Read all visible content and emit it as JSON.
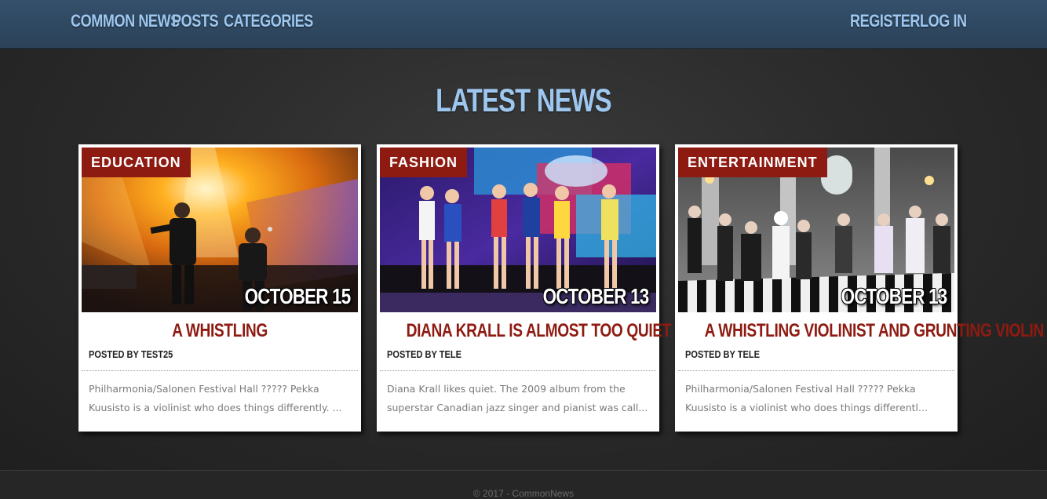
{
  "nav": {
    "brand": "COMMON NEWS",
    "posts": "POSTS",
    "categories": "CATEGORIES",
    "register": "REGISTER",
    "login": "LOG IN"
  },
  "section_title": "LATEST NEWS",
  "cards": [
    {
      "category": "EDUCATION",
      "date": "OCTOBER 15",
      "title": "A WHISTLING",
      "posted_by": "POSTED BY TEST25",
      "excerpt": "Philharmonia/Salonen Festival Hall ????? Pekka Kuusisto is a violinist who does things differently. ..."
    },
    {
      "category": "FASHION",
      "date": "OCTOBER 13",
      "title": "DIANA KRALL IS ALMOST TOO QUIET",
      "posted_by": "POSTED BY TELE",
      "excerpt": "Diana Krall likes quiet. The 2009 album from the superstar Canadian jazz singer and pianist was call..."
    },
    {
      "category": "ENTERTAINMENT",
      "date": "OCTOBER 13",
      "title": "A WHISTLING VIOLINIST AND GRUNTING VIOLIN",
      "posted_by": "POSTED BY TELE",
      "excerpt": "Philharmonia/Salonen Festival Hall ????? Pekka Kuusisto is a violinist who does things differentl..."
    }
  ],
  "footer": {
    "text": "© 2017 - CommonNews"
  }
}
